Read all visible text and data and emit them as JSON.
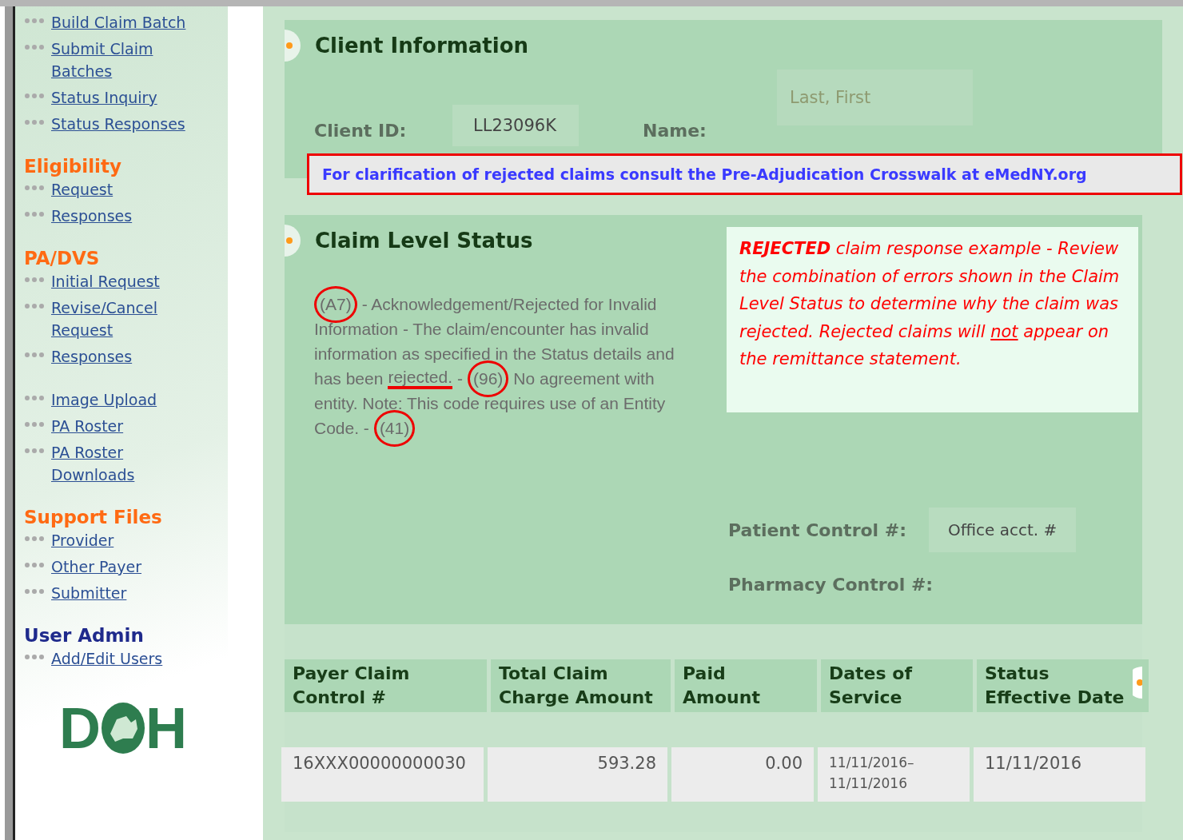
{
  "sidebar": {
    "groups": [
      {
        "links": [
          "Build Claim Batch",
          "Submit Claim Batches",
          "Status Inquiry",
          "Status Responses"
        ]
      },
      {
        "heading": "Eligibility",
        "color": "#ff6a13",
        "links": [
          "Request",
          "Responses"
        ]
      },
      {
        "heading": "PA/DVS",
        "color": "#ff6a13",
        "links": [
          "Initial Request",
          "Revise/Cancel Request",
          "Responses"
        ]
      },
      {
        "links": [
          "Image Upload",
          "PA Roster",
          "PA Roster Downloads"
        ]
      },
      {
        "heading": "Support Files",
        "color": "#ff6a13",
        "links": [
          "Provider",
          "Other Payer",
          "Submitter"
        ]
      },
      {
        "heading": "User Admin",
        "color": "#1f2a8c",
        "links": [
          "Add/Edit Users"
        ]
      }
    ],
    "logo": {
      "left": "D",
      "right": "H"
    }
  },
  "client_information": {
    "title": "Client Information",
    "client_id_label": "Client ID:",
    "client_id": "LL23096K",
    "name_label": "Name:",
    "name_placeholder": "Last, First"
  },
  "notice": "For clarification of rejected claims consult the Pre-Adjudication Crosswalk at eMedNY.org",
  "claim_level_status": {
    "title": "Claim Level Status",
    "status_lines": [
      [
        {
          "kind": "code",
          "text": "(A7)"
        },
        {
          "kind": "text",
          "text": "- Acknowledgement/Rejected for Invalid"
        }
      ],
      [
        {
          "kind": "text",
          "text": "Information - The claim/encounter has invalid"
        }
      ],
      [
        {
          "kind": "text",
          "text": "information as specified in the Status details and"
        }
      ],
      [
        {
          "kind": "text",
          "text": "has been"
        },
        {
          "kind": "underlined",
          "text": "rejected."
        },
        {
          "kind": "text",
          "text": "-"
        },
        {
          "kind": "code",
          "text": "(96)"
        },
        {
          "kind": "text",
          "text": "No agreement with"
        }
      ],
      [
        {
          "kind": "text",
          "text": "entity. Note: This code requires use of an Entity"
        }
      ],
      [
        {
          "kind": "text",
          "text": "Code. -"
        },
        {
          "kind": "code",
          "text": "(41)"
        }
      ]
    ],
    "callout": {
      "before": "**REJECTED** claim response example - Review the combination of errors shown in the Claim Level Status to determine why the claim was rejected. Rejected claims will",
      "underlined": "not",
      "after": "appear on the remittance statement."
    },
    "patient_control_label": "Patient Control #:",
    "patient_control": "Office acct. #",
    "pharmacy_control_label": "Pharmacy Control #:"
  },
  "table": {
    "columns": [
      "Payer Claim Control #",
      "Total Claim Charge Amount",
      "Paid Amount",
      "Dates of Service",
      "Status Effective Date"
    ],
    "rows": [
      [
        "16XXX00000000030",
        "593.28",
        "0.00",
        "11/11/2016–\n11/11/2016",
        "11/11/2016"
      ]
    ]
  }
}
